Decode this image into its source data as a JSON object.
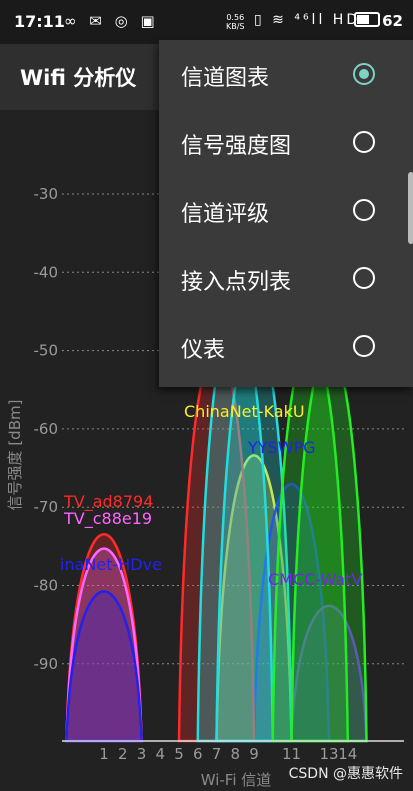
{
  "status_bar": {
    "time": "17:11",
    "left_icons": "∞ ✉ ◎ ▣",
    "speed_value": "0.56",
    "speed_unit": "KB/S",
    "right_icons": "▯ ≋ ⁴⁶ll HD",
    "battery_level": "62"
  },
  "app": {
    "title": "Wifi 分析仪"
  },
  "menu": {
    "items": [
      {
        "label": "信道图表",
        "checked": true
      },
      {
        "label": "信号强度图",
        "checked": false
      },
      {
        "label": "信道评级",
        "checked": false
      },
      {
        "label": "接入点列表",
        "checked": false
      },
      {
        "label": "仪表",
        "checked": false
      }
    ]
  },
  "chart_data": {
    "type": "area",
    "xlabel": "Wi-Fi 信道",
    "ylabel": "信号强度 [dBm]",
    "y_ticks": [
      -30,
      -40,
      -50,
      -60,
      -70,
      -80,
      -90
    ],
    "x_ticks": [
      1,
      2,
      3,
      4,
      5,
      6,
      7,
      8,
      9,
      10,
      11,
      12,
      13,
      14
    ],
    "x_tick_labels": [
      "1",
      "2",
      "3",
      "4",
      "5",
      "6",
      "7",
      "8",
      "9",
      "",
      "11",
      "",
      "13",
      "14"
    ],
    "ylim": [
      -100,
      -20
    ],
    "xlim": [
      -2,
      16
    ],
    "networks": [
      {
        "name": "TV_ad8794",
        "channel": 1,
        "dbm": -71,
        "color": "#ff2a2a",
        "label_color": "#ff2a2a"
      },
      {
        "name": "TV_c88e19",
        "channel": 1,
        "dbm": -73,
        "color": "#ff66ff",
        "label_color": "#ff66ff"
      },
      {
        "name": "inaNet-HDve",
        "channel": 1,
        "dbm": -79,
        "color": "#2222ee",
        "label_color": "#2222ee"
      },
      {
        "name": "ChinaNet-KakU",
        "channel": 9,
        "dbm": -60,
        "color": "#ffee22",
        "label_color": "#ffee22"
      },
      {
        "name": "YYSWPG",
        "channel": 11,
        "dbm": -64,
        "color": "#2222ee",
        "label_color": "#2222ee"
      },
      {
        "name": "CMCC-WatV",
        "channel": 13,
        "dbm": -81,
        "color": "#7722ee",
        "label_color": "#7722ee"
      },
      {
        "name": "",
        "channel": 7,
        "dbm": -45,
        "color": "#ff2a2a",
        "label_color": ""
      },
      {
        "name": "",
        "channel": 8,
        "dbm": -40,
        "color": "#22dddd",
        "label_color": ""
      },
      {
        "name": "",
        "channel": 9,
        "dbm": -42,
        "color": "#22dddd",
        "label_color": ""
      },
      {
        "name": "",
        "channel": 12,
        "dbm": -44,
        "color": "#22ee22",
        "label_color": ""
      },
      {
        "name": "",
        "channel": 13,
        "dbm": -45,
        "color": "#22ee22",
        "label_color": ""
      }
    ]
  },
  "watermark": "CSDN @惠惠软件"
}
